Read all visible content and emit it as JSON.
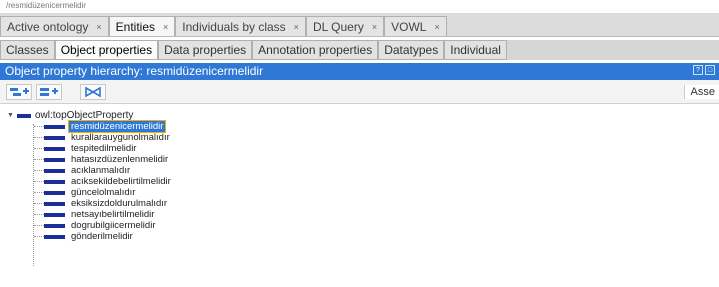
{
  "breadcrumb": "/resmidüzenicermelidir",
  "main_tabs": [
    {
      "label": "Active ontology",
      "close": "×",
      "active": false
    },
    {
      "label": "Entities",
      "close": "×",
      "active": true
    },
    {
      "label": "Individuals by class",
      "close": "×",
      "active": false
    },
    {
      "label": "DL Query",
      "close": "×",
      "active": false
    },
    {
      "label": "VOWL",
      "close": "×",
      "active": false
    }
  ],
  "sub_tabs": [
    {
      "label": "Classes",
      "active": false
    },
    {
      "label": "Object properties",
      "active": true
    },
    {
      "label": "Data properties",
      "active": false
    },
    {
      "label": "Annotation properties",
      "active": false
    },
    {
      "label": "Datatypes",
      "active": false
    },
    {
      "label": "Individual",
      "active": false
    }
  ],
  "panel": {
    "title": "Object property hierarchy: resmidüzenicermelidir",
    "asserted_label": "Asse",
    "toolbar_icons": [
      "add-subproperty-icon",
      "add-sibling-property-icon",
      "delete-property-icon"
    ],
    "window_icons": [
      "view-options-icon",
      "view-close-icon"
    ]
  },
  "tree": {
    "root": {
      "label": "owl:topObjectProperty",
      "expanded": true
    },
    "children": [
      {
        "label": "resmidüzenicermelidir",
        "selected": true
      },
      {
        "label": "kurallarauygunolmalıdır",
        "selected": false
      },
      {
        "label": "tespitedilmelidir",
        "selected": false
      },
      {
        "label": "hatasızdüzenlenmelidir",
        "selected": false
      },
      {
        "label": "acıklanmalıdır",
        "selected": false
      },
      {
        "label": "acıksekildebelirtilmelidir",
        "selected": false
      },
      {
        "label": "güncelolmalıdır",
        "selected": false
      },
      {
        "label": "eksiksizdoldurulmalıdır",
        "selected": false
      },
      {
        "label": "netsayıbelirtilmelidir",
        "selected": false
      },
      {
        "label": "dogrubilgiicermelidir",
        "selected": false
      },
      {
        "label": "gönderilmelidir",
        "selected": false
      }
    ]
  },
  "colors": {
    "selection": "#2f78d6",
    "property_bar": "#1a2f9a",
    "title_bar": "#2f78d6"
  }
}
